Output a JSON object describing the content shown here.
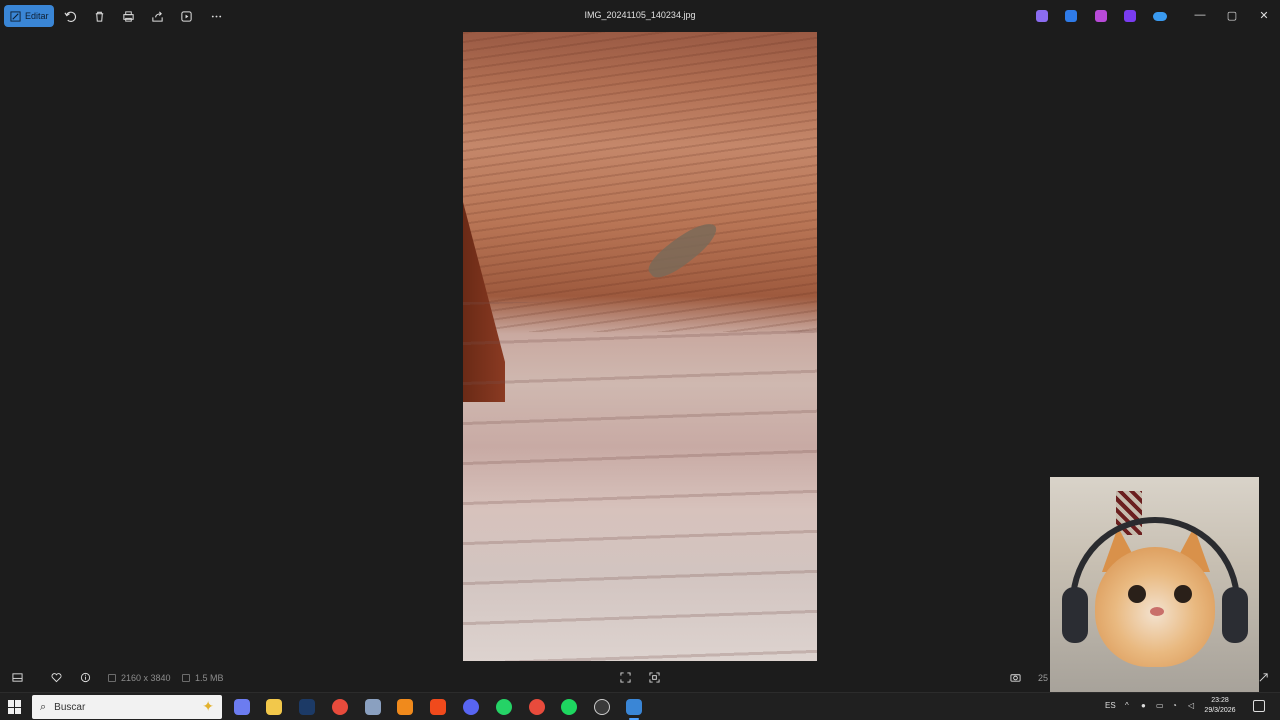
{
  "toolbar": {
    "edit_label": "Editar",
    "icons": [
      "rotate-icon",
      "delete-icon",
      "print-icon",
      "share-icon",
      "slideshow-icon",
      "more-icon"
    ]
  },
  "window": {
    "title": "IMG_20241105_140234.jpg",
    "extensions": [
      {
        "name": "copilot-icon",
        "color": "#8b6cf0"
      },
      {
        "name": "designer-icon",
        "color": "#2f7be8"
      },
      {
        "name": "video-editor-icon",
        "color": "#b84ad8"
      },
      {
        "name": "clipchamp-icon",
        "color": "#7a3cf0"
      },
      {
        "name": "onedrive-icon",
        "color": "#3a9af0"
      }
    ]
  },
  "info": {
    "dimensions": "2160 x 3840",
    "file_size": "1.5 MB",
    "zoom": "25"
  },
  "taskbar": {
    "search_placeholder": "Buscar",
    "apps": [
      {
        "name": "copilot-app",
        "color": "#6c7cf0"
      },
      {
        "name": "file-explorer-app",
        "color": "#f2c84b"
      },
      {
        "name": "photoshop-app",
        "color": "#1c3a66"
      },
      {
        "name": "chrome-app",
        "color": "#e84b3c"
      },
      {
        "name": "app-5",
        "color": "#8aa0c0"
      },
      {
        "name": "fl-studio-app",
        "color": "#f08a1c"
      },
      {
        "name": "brave-app",
        "color": "#f04a1c"
      },
      {
        "name": "discord-app",
        "color": "#5865f2"
      },
      {
        "name": "whatsapp-app",
        "color": "#25d366"
      },
      {
        "name": "chrome-alt-app",
        "color": "#e84b3c"
      },
      {
        "name": "spotify-app",
        "color": "#1ed760"
      },
      {
        "name": "obs-app",
        "color": "#3a3a3a"
      },
      {
        "name": "photos-app",
        "color": "#3a86d6"
      }
    ],
    "language": "ES",
    "time": "23:28",
    "date": "29/3/2026"
  }
}
